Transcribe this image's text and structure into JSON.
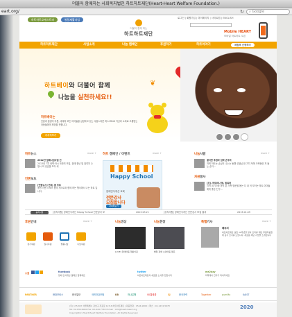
{
  "browser": {
    "title": "더불어 함께하는 사회복지법인 하트하트재단(Heart-Heart Welfare Foundation.)",
    "url": "eart.org/",
    "search_placeholder": "Google"
  },
  "header": {
    "pill1": "하트하트오케스트라",
    "pill2": "발달재활사업",
    "util_links": "로그인 | 회원가입 | 마이페이지 | 사이트맵 | ENGLISH",
    "search_btn": "검색",
    "logo_sub": "더불어 함께 하는",
    "logo_main": "하트하트재단",
    "promo_title": "Mobile HEART",
    "promo_sub": "모바일 하트하트 오픈"
  },
  "nav": {
    "items": [
      "하트하트재단",
      "사업소개",
      "나눔 캠페인",
      "후원하기",
      "하트이야기"
    ],
    "cta": "체험후 신청하기"
  },
  "hero": {
    "line1_a": "하트베이",
    "line1_b": "와 더불어 함께",
    "line2_a": "나눔을 ",
    "line2_b": "실천하세요!!",
    "label": "하트베이는",
    "desc": "인종과 환경이 다른, 세계의 모든 아이들을 상징하고 있는 사랑스러운 마스코트로 가난과 소외로 고통받는 아동들에게 희망을 전합니다.",
    "more": "자세히보기"
  },
  "news": {
    "title_a": "하트",
    "title_b": "뉴스",
    "more": "more +",
    "line1": "2012년 밀레니엄사업 선",
    "line2": "2013년 7월 새벽·아시 아반의 모집, 장애 청년 및 참여자 수",
    "line3": "청시 외 성금을 모두 세",
    "press_title_a": "언론",
    "press_title_b": "보도",
    "press1": "[연합뉴스] 한세, 봄 프로",
    "press2": "후원 이젠 스포츠 등의 게스트와 함께 하는 행사에서 나는 하트 입니다."
  },
  "campaign": {
    "title_a": "하트",
    "title_b": " 캠페인 / 이벤트",
    "more": "more +",
    "hs_title": "Happy School",
    "hs_c1": "장애인식개선 교육",
    "hs_c2": "전문강사",
    "hs_c3": "모집합니다",
    "apply": "자세히보기"
  },
  "people": {
    "title_a": "나눔",
    "title_b": "사람",
    "more": "more +",
    "p1": "결식한 후원자 엄마 손주의",
    "p1d": "저희 하트는 손님이 나누는 동행 선생님 한 가지 덕에 오랫동안 저 돕는 손자...",
    "p2_title_a": "자원",
    "p2_title_b": "봉사",
    "p2": "[조]. 하트바나 봉, 동료와",
    "p2d": "지역 위기가정 아이 온 가족 방문을 돕는 다 내 어 보이는 하트 아이들에게 좋은 친구..."
  },
  "ticker": {
    "label": "공지사항",
    "item1": "[공지사항] 장애인식개선 Happy School 전문강사 모",
    "date1": "2013.03.21",
    "item2": "[공지사항] 장애인식개선 전문강사 모집 결과",
    "date2": "2013.01.09"
  },
  "bottom": {
    "support_title_a": "후원",
    "support_title_b": "안내",
    "support_more": "more +",
    "icon_caps": [
      "정기후원",
      "일시후원",
      "물품나눔",
      "나눔후원"
    ],
    "video_title_a": "나눔",
    "video_title_b": "영상",
    "video_caption": "[LIVE] 장애아동 재활치료",
    "video2_title_a": "나눔",
    "video2_title_b": "현장",
    "video2_caption": "발달 장애 소외아동 캠프",
    "story_title_a": "특별",
    "story_title_b": "기사",
    "story_more": "more +",
    "story1": "제위지",
    "story_desc": "하트하트재단 설립 30주년을 맞아 인터뷰 재단 후원자분들께 감사 인사를 드립니다. 새로운 재단 사업을 소개합니다"
  },
  "social": {
    "label": "소셜",
    "fb": "facebook",
    "fb_desc": "장애 인식개선 캠페인 함께해요",
    "tw": "twitter",
    "tw_desc": "하트하트재단의 새로운 소식을 전합니다",
    "me2": "me2day",
    "me2_desc": "미투데이 친구가 되어주세요"
  },
  "partners": {
    "label": "PARTNER",
    "items": [
      "현대모비스",
      "한국일보",
      "국민건강보험",
      "KB",
      "하나은행",
      "SK텔레콤",
      "CJ",
      "한국전력",
      "Together",
      "pumMo",
      "KAIST"
    ]
  },
  "footer": {
    "address": "(우) 135-827 서울특별시 강남구 개포로 123-6 하트하트재단 | 대표전화 : 1544-9000 | 팩스 : 02-1234-5678",
    "contact": "Tel. 02-430-0000 Fax. 02-444-7763 E-mail : info@heart-heart.org",
    "copy": "Copyright(c) Heart-Heart Welfare Foundation. All Rights Reserved.",
    "badge": "2020"
  },
  "colors": {
    "accent": "#f2a400",
    "orange_text": "#e55b0c",
    "blue": "#1e73b4",
    "green": "#7a9a3c"
  }
}
